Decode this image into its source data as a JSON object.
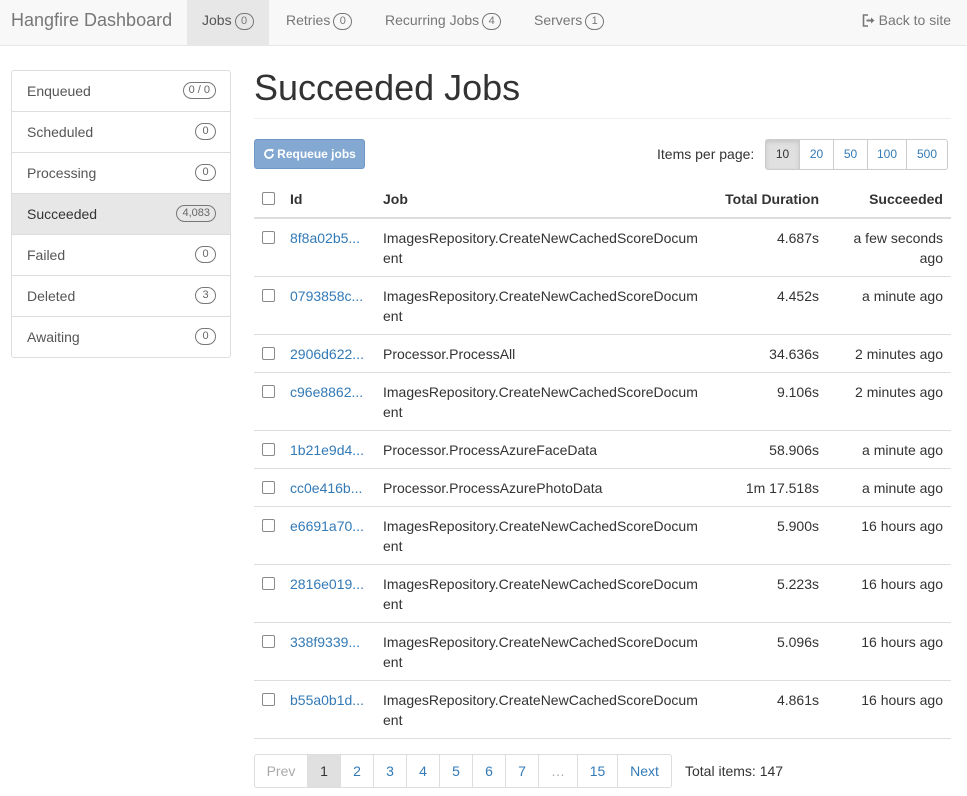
{
  "navbar": {
    "brand": "Hangfire Dashboard",
    "items": [
      {
        "label": "Jobs",
        "badge": "0"
      },
      {
        "label": "Retries",
        "badge": "0"
      },
      {
        "label": "Recurring Jobs",
        "badge": "4"
      },
      {
        "label": "Servers",
        "badge": "1"
      }
    ],
    "back_label": "Back to site"
  },
  "sidebar": {
    "items": [
      {
        "label": "Enqueued",
        "badge": "0 / 0"
      },
      {
        "label": "Scheduled",
        "badge": "0"
      },
      {
        "label": "Processing",
        "badge": "0"
      },
      {
        "label": "Succeeded",
        "badge": "4,083"
      },
      {
        "label": "Failed",
        "badge": "0"
      },
      {
        "label": "Deleted",
        "badge": "3"
      },
      {
        "label": "Awaiting",
        "badge": "0"
      }
    ]
  },
  "main": {
    "title": "Succeeded Jobs",
    "requeue_label": "Requeue jobs",
    "items_per_page_label": "Items per page:",
    "items_per_page_options": [
      "10",
      "20",
      "50",
      "100",
      "500"
    ],
    "items_per_page_selected": "10"
  },
  "table": {
    "headers": {
      "id": "Id",
      "job": "Job",
      "duration": "Total Duration",
      "succeeded": "Succeeded"
    },
    "rows": [
      {
        "id": "8f8a02b5...",
        "job": "ImagesRepository.CreateNewCachedScoreDocument",
        "duration": "4.687s",
        "succeeded": "a few seconds ago"
      },
      {
        "id": "0793858c...",
        "job": "ImagesRepository.CreateNewCachedScoreDocument",
        "duration": "4.452s",
        "succeeded": "a minute ago"
      },
      {
        "id": "2906d622...",
        "job": "Processor.ProcessAll",
        "duration": "34.636s",
        "succeeded": "2 minutes ago"
      },
      {
        "id": "c96e8862...",
        "job": "ImagesRepository.CreateNewCachedScoreDocument",
        "duration": "9.106s",
        "succeeded": "2 minutes ago"
      },
      {
        "id": "1b21e9d4...",
        "job": "Processor.ProcessAzureFaceData",
        "duration": "58.906s",
        "succeeded": "a minute ago"
      },
      {
        "id": "cc0e416b...",
        "job": "Processor.ProcessAzurePhotoData",
        "duration": "1m 17.518s",
        "succeeded": "a minute ago"
      },
      {
        "id": "e6691a70...",
        "job": "ImagesRepository.CreateNewCachedScoreDocument",
        "duration": "5.900s",
        "succeeded": "16 hours ago"
      },
      {
        "id": "2816e019...",
        "job": "ImagesRepository.CreateNewCachedScoreDocument",
        "duration": "5.223s",
        "succeeded": "16 hours ago"
      },
      {
        "id": "338f9339...",
        "job": "ImagesRepository.CreateNewCachedScoreDocument",
        "duration": "5.096s",
        "succeeded": "16 hours ago"
      },
      {
        "id": "b55a0b1d...",
        "job": "ImagesRepository.CreateNewCachedScoreDocument",
        "duration": "4.861s",
        "succeeded": "16 hours ago"
      }
    ]
  },
  "pagination": {
    "prev_label": "Prev",
    "pages": [
      "1",
      "2",
      "3",
      "4",
      "5",
      "6",
      "7"
    ],
    "ellipsis": "…",
    "last_page": "15",
    "next_label": "Next",
    "current_page": "1",
    "total_label": "Total items: 147"
  }
}
